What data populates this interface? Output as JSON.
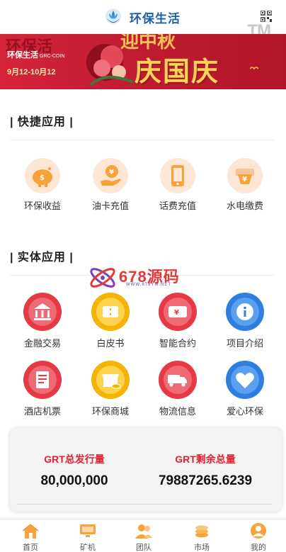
{
  "header": {
    "title": "环保生活",
    "logo_icon": "lotus-hands-icon",
    "qr_icon": "qrcode-icon",
    "tm": "TM"
  },
  "banner": {
    "red_sub": "环保活",
    "brand": "环保生活",
    "brand_small": "GRC-COIN",
    "dates": "9月12-10月12",
    "festival_top": "迎中秋",
    "festival": "庆国庆"
  },
  "quick": {
    "title": "| 快捷应用 |",
    "items": [
      {
        "label": "环保收益",
        "icon": "piggy-bank-icon"
      },
      {
        "label": "油卡充值",
        "icon": "coin-hand-icon"
      },
      {
        "label": "话费充值",
        "icon": "phone-icon"
      },
      {
        "label": "水电缴费",
        "icon": "yen-bill-icon"
      }
    ]
  },
  "physical": {
    "title": "| 实体应用 |",
    "items": [
      {
        "label": "金融交易",
        "icon": "bank-icon",
        "color": "#e63946"
      },
      {
        "label": "白皮书",
        "icon": "ticket-icon",
        "color": "#f4b400"
      },
      {
        "label": "智能合约",
        "icon": "yen-ticket-icon",
        "color": "#e63946"
      },
      {
        "label": "项目介绍",
        "icon": "info-icon",
        "color": "#2f7fe0"
      },
      {
        "label": "酒店机票",
        "icon": "document-icon",
        "color": "#e63946"
      },
      {
        "label": "环保商城",
        "icon": "shop-icon",
        "color": "#f4b400"
      },
      {
        "label": "物流信息",
        "icon": "truck-icon",
        "color": "#e63946"
      },
      {
        "label": "爱心环保",
        "icon": "heart-icon",
        "color": "#2f7fe0"
      }
    ]
  },
  "stats": {
    "issued_label": "GRT总发行量",
    "issued_value": "80,000,000",
    "remaining_label": "GRT剩余总量",
    "remaining_value": "79887265.6239"
  },
  "watermark": {
    "text": "678源码",
    "url": "WWW.678YM.NET"
  },
  "tabs": [
    {
      "label": "首页",
      "icon": "home-icon"
    },
    {
      "label": "矿机",
      "icon": "monitor-icon"
    },
    {
      "label": "团队",
      "icon": "team-icon"
    },
    {
      "label": "市场",
      "icon": "coins-icon"
    },
    {
      "label": "我的",
      "icon": "user-icon"
    }
  ],
  "colors": {
    "brand_blue": "#1d5fa8",
    "accent_red": "#e0212f",
    "icon_orange": "#f7a23b",
    "icon_peach_bg": "#fde6d3"
  }
}
